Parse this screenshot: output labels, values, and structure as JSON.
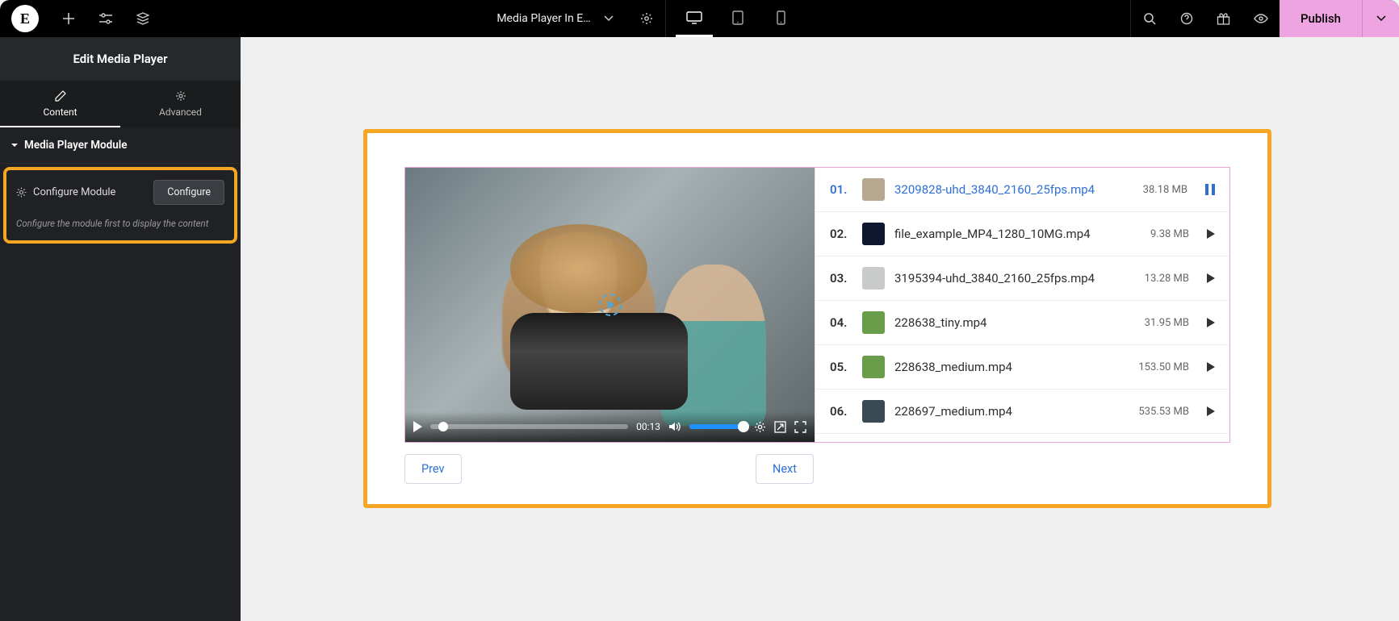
{
  "topbar": {
    "page_name": "Media Player In E…",
    "publish_label": "Publish"
  },
  "sidebar": {
    "panel_title": "Edit Media Player",
    "tabs": {
      "content": "Content",
      "advanced": "Advanced"
    },
    "section_title": "Media Player Module",
    "configure_label": "Configure Module",
    "configure_btn": "Configure",
    "configure_desc": "Configure the module first to display the content"
  },
  "player": {
    "time": "00:13",
    "nav_prev": "Prev",
    "nav_next": "Next"
  },
  "playlist": [
    {
      "num": "01.",
      "name": "3209828-uhd_3840_2160_25fps.mp4",
      "size": "38.18 MB",
      "active": true,
      "thumb": "#b7a88f"
    },
    {
      "num": "02.",
      "name": "file_example_MP4_1280_10MG.mp4",
      "size": "9.38 MB",
      "active": false,
      "thumb": "#0f1730"
    },
    {
      "num": "03.",
      "name": "3195394-uhd_3840_2160_25fps.mp4",
      "size": "13.28 MB",
      "active": false,
      "thumb": "#c9cbca"
    },
    {
      "num": "04.",
      "name": "228638_tiny.mp4",
      "size": "31.95 MB",
      "active": false,
      "thumb": "#6a9d4a"
    },
    {
      "num": "05.",
      "name": "228638_medium.mp4",
      "size": "153.50 MB",
      "active": false,
      "thumb": "#6a9d4a"
    },
    {
      "num": "06.",
      "name": "228697_medium.mp4",
      "size": "535.53 MB",
      "active": false,
      "thumb": "#3a4a55"
    }
  ]
}
